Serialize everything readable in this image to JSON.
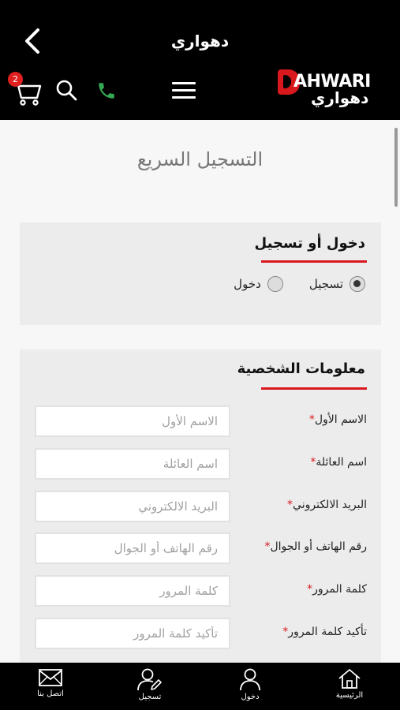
{
  "header": {
    "title": "دهواري",
    "cart_count": "2",
    "logo_en": "AHWARI",
    "logo_ar": "دهواري",
    "accent_color": "#d8181d",
    "phone_color": "#34a853"
  },
  "main": {
    "page_title": "التسجيل السريع",
    "login_section": {
      "title": "دخول أو تسجيل",
      "options": [
        "تسجيل",
        "دخول"
      ],
      "selected": "تسجيل"
    },
    "personal_section": {
      "title": "معلومات الشخصية",
      "fields": [
        {
          "label": "الاسم الأول",
          "placeholder": "الاسم الأول"
        },
        {
          "label": "اسم العائلة",
          "placeholder": "اسم العائلة"
        },
        {
          "label": "البريد الالكتروني",
          "placeholder": "البريد الالكتروني"
        },
        {
          "label": "رقم الهاتف أو الجوال",
          "placeholder": "رقم الهاتف أو الجوال"
        },
        {
          "label": "كلمة المرور",
          "placeholder": "كلمة المرور"
        },
        {
          "label": "تأكيد كلمة المرور",
          "placeholder": "تأكيد كلمة المرور"
        }
      ],
      "required_mark": "*"
    }
  },
  "tabbar": {
    "items": [
      {
        "label": "الرئيسية",
        "icon": "home-icon"
      },
      {
        "label": "دخول",
        "icon": "user-icon"
      },
      {
        "label": "تسجيل",
        "icon": "user-edit-icon"
      },
      {
        "label": "اتصل بنا",
        "icon": "mail-icon"
      }
    ]
  }
}
